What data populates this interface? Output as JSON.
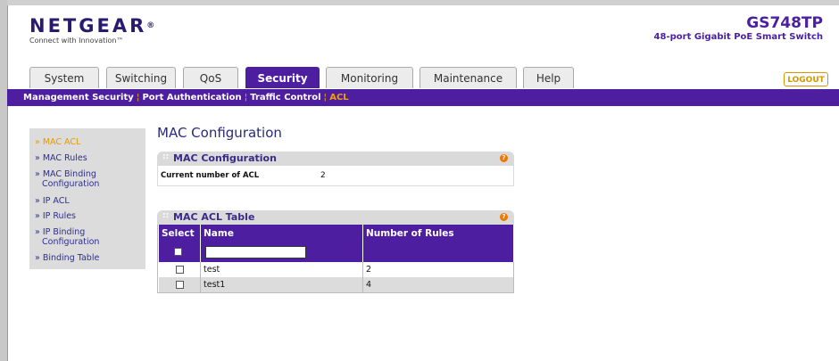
{
  "brand": {
    "logo_text": "NETGEAR",
    "logo_reg": "®",
    "tagline": "Connect with Innovation™",
    "model": "GS748TP",
    "model_desc": "48-port Gigabit PoE Smart Switch",
    "accent_color": "#4e1ea0",
    "highlight_color": "#f0a000"
  },
  "tabs": [
    {
      "label": "System"
    },
    {
      "label": "Switching"
    },
    {
      "label": "QoS"
    },
    {
      "label": "Security",
      "active": true
    },
    {
      "label": "Monitoring"
    },
    {
      "label": "Maintenance"
    },
    {
      "label": "Help"
    }
  ],
  "logout_label": "LOGOUT",
  "subnav": {
    "items": [
      "Management Security",
      "Port Authentication",
      "Traffic Control",
      "ACL"
    ],
    "current": "ACL"
  },
  "sidebar": {
    "items": [
      {
        "label": "» MAC ACL",
        "current": true
      },
      {
        "label": "» MAC Rules"
      },
      {
        "label": "» MAC Binding",
        "label2": "Configuration"
      },
      {
        "label": "» IP ACL"
      },
      {
        "label": "» IP Rules"
      },
      {
        "label": "» IP Binding",
        "label2": "Configuration"
      },
      {
        "label": "» Binding Table"
      }
    ]
  },
  "main": {
    "page_title": "MAC Configuration",
    "config_panel": {
      "title": "MAC Configuration",
      "help_icon": "?",
      "field_label": "Current number of ACL",
      "field_value": "2"
    },
    "table_panel": {
      "title": "MAC ACL Table",
      "help_icon": "?",
      "columns": [
        "Select",
        "Name",
        "Number of Rules"
      ],
      "name_input_value": "",
      "rows": [
        {
          "name": "test",
          "rules": "2"
        },
        {
          "name": "test1",
          "rules": "4"
        }
      ]
    }
  }
}
